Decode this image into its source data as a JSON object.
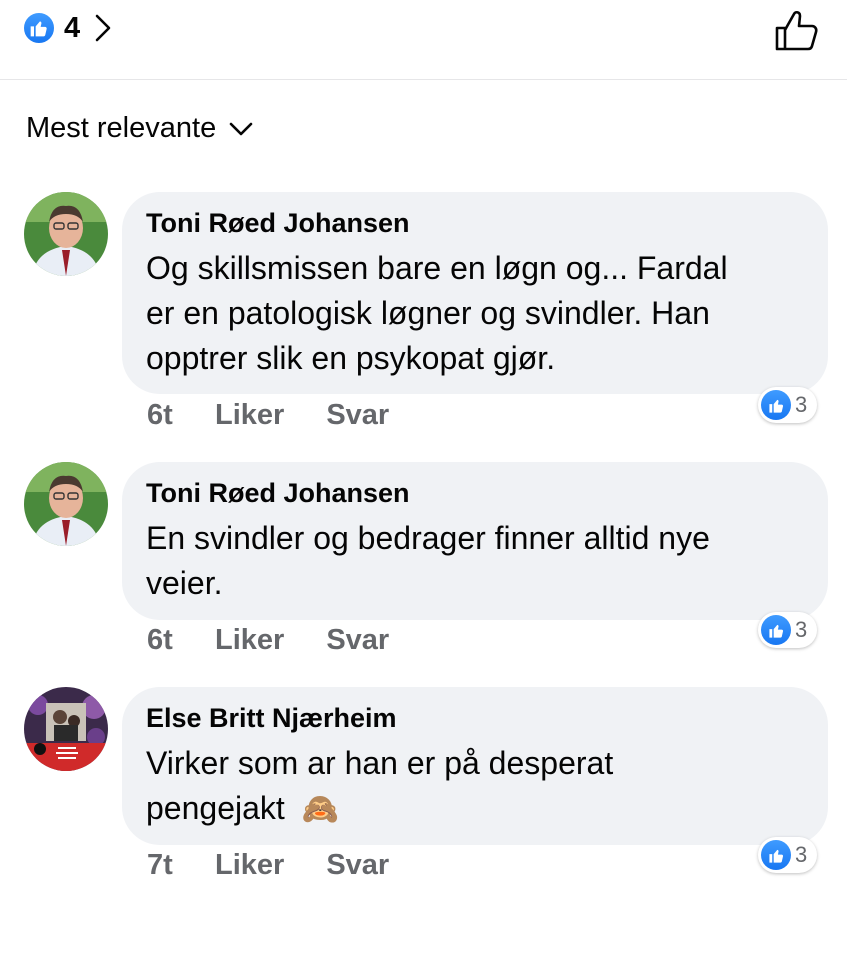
{
  "header": {
    "reaction_count": "4"
  },
  "sort": {
    "label": "Mest relevante"
  },
  "actions": {
    "like_label": "Liker",
    "reply_label": "Svar"
  },
  "comments": [
    {
      "author": "Toni Røed Johansen",
      "lines": [
        "Og skillsmissen bare en løgn og... Fardal",
        "er en patologisk løgner og svindler. Han",
        "opptrer slik en psykopat gjør."
      ],
      "time": "6t",
      "reactions": "3"
    },
    {
      "author": "Toni Røed Johansen",
      "lines": [
        "En svindler og bedrager finner alltid nye",
        "veier."
      ],
      "time": "6t",
      "reactions": "3"
    },
    {
      "author": "Else Britt Njærheim",
      "lines": [
        "Virker som ar han er på desperat",
        "pengejakt"
      ],
      "emoji": "🙈",
      "time": "7t",
      "reactions": "3"
    }
  ],
  "colors": {
    "accent": "#1877f2",
    "bubble": "#f0f2f5",
    "secondary_text": "#65676b"
  }
}
